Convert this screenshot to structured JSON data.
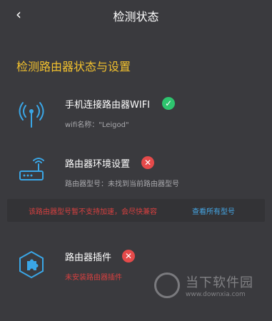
{
  "header": {
    "back_glyph": "‹",
    "title": "检测状态"
  },
  "section_title": "检测路由器状态与设置",
  "items": [
    {
      "icon": "wifi-signal-icon",
      "title": "手机连接路由器WIFI",
      "status": "ok",
      "status_glyph": "✓",
      "subtitle": "wifi名称：\"Leigod\""
    },
    {
      "icon": "router-icon",
      "title": "路由器环境设置",
      "status": "error",
      "status_glyph": "✕",
      "subtitle": "路由器型号：未找到当前路由器型号"
    },
    {
      "icon": "plugin-puzzle-icon",
      "title": "路由器插件",
      "status": "error",
      "status_glyph": "✕",
      "subtitle": "未安装路由器插件"
    }
  ],
  "warning": {
    "text": "该路由器型号暂不支持加速，会尽快兼容",
    "link": "查看所有型号"
  },
  "watermark": {
    "text": "当下软件园",
    "url": "www.downxia.com"
  },
  "colors": {
    "background": "#3a3a3e",
    "accent_yellow": "#f2c12e",
    "icon_blue": "#3aa6e6",
    "ok_green": "#2ec46e",
    "error_red": "#e54a4a",
    "link_blue": "#45a7e6"
  }
}
